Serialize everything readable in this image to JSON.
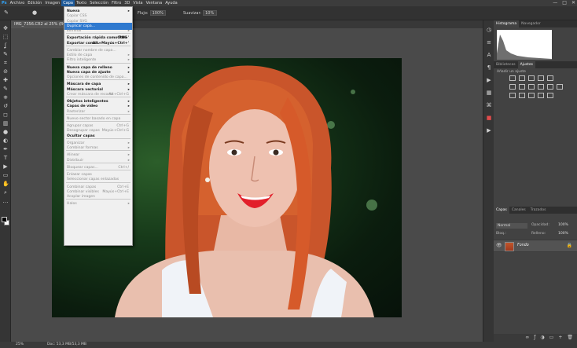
{
  "menubar": {
    "items": [
      "Archivo",
      "Edición",
      "Imagen",
      "Capa",
      "Texto",
      "Selección",
      "Filtro",
      "3D",
      "Vista",
      "Ventana",
      "Ayuda"
    ],
    "active": "Capa",
    "window_controls": [
      "—",
      "□",
      "✕"
    ]
  },
  "options": {
    "flujo_label": "Flujo:",
    "flujo_value": "100%",
    "suavizar_label": "Suavizar:",
    "suavizar_value": "10%"
  },
  "document_tab": "IMG_7356.CR2 al 25% (RGB",
  "status": {
    "zoom": "25%",
    "doc": "Doc: 53,3 MB/53,3 MB"
  },
  "menu": {
    "items": [
      {
        "label": "Nueva",
        "style": "bold",
        "arrow": true
      },
      {
        "label": "Copiar CSS",
        "style": "dis"
      },
      {
        "label": "Copiar SVG",
        "style": "dis"
      },
      {
        "label": "Duplicar capa...",
        "style": "hl"
      },
      {
        "label": "Eliminar",
        "style": "dis",
        "arrow": true
      },
      {
        "sep": true
      },
      {
        "label": "Exportación rápida como PNG",
        "style": "bold",
        "shortcut": "Ctrl+'"
      },
      {
        "label": "Exportar como...",
        "style": "bold",
        "shortcut": "Alt+Mayús+Ctrl+'"
      },
      {
        "sep": true
      },
      {
        "label": "Cambiar nombre de capa...",
        "style": "dis"
      },
      {
        "label": "Estilo de capa",
        "style": "dis",
        "arrow": true
      },
      {
        "label": "Filtro inteligente",
        "style": "dis",
        "arrow": true
      },
      {
        "sep": true
      },
      {
        "label": "Nueva capa de relleno",
        "style": "bold",
        "arrow": true
      },
      {
        "label": "Nueva capa de ajuste",
        "style": "bold",
        "arrow": true
      },
      {
        "label": "Opciones de contenido de capa...",
        "style": "dis"
      },
      {
        "sep": true
      },
      {
        "label": "Máscara de capa",
        "style": "bold",
        "arrow": true
      },
      {
        "label": "Máscara vectorial",
        "style": "bold",
        "arrow": true
      },
      {
        "label": "Crear máscara de recorte",
        "style": "dis",
        "shortcut": "Alt+Ctrl+G"
      },
      {
        "sep": true
      },
      {
        "label": "Objetos inteligentes",
        "style": "bold",
        "arrow": true
      },
      {
        "label": "Capas de vídeo",
        "style": "bold",
        "arrow": true
      },
      {
        "label": "Rasterizar",
        "style": "dis",
        "arrow": true
      },
      {
        "sep": true
      },
      {
        "label": "Nuevo sector basado en capa",
        "style": "dis"
      },
      {
        "sep": true
      },
      {
        "label": "Agrupar capas",
        "style": "dis",
        "shortcut": "Ctrl+G"
      },
      {
        "label": "Desagrupar capas",
        "style": "dis",
        "shortcut": "Mayús+Ctrl+G"
      },
      {
        "label": "Ocultar capas",
        "style": "bold"
      },
      {
        "sep": true
      },
      {
        "label": "Organizar",
        "style": "dis",
        "arrow": true
      },
      {
        "label": "Combinar formas",
        "style": "dis",
        "arrow": true
      },
      {
        "sep": true
      },
      {
        "label": "Alinear",
        "style": "dis",
        "arrow": true
      },
      {
        "label": "Distribuir",
        "style": "dis",
        "arrow": true
      },
      {
        "sep": true
      },
      {
        "label": "Bloquear capas...",
        "style": "dis",
        "shortcut": "Ctrl+/"
      },
      {
        "sep": true
      },
      {
        "label": "Enlazar capas",
        "style": "dis"
      },
      {
        "label": "Seleccionar capas enlazadas",
        "style": "dis"
      },
      {
        "sep": true
      },
      {
        "label": "Combinar capas",
        "style": "dis",
        "shortcut": "Ctrl+E"
      },
      {
        "label": "Combinar visibles",
        "style": "dis",
        "shortcut": "Mayús+Ctrl+E"
      },
      {
        "label": "Acoplar imagen",
        "style": "dis"
      },
      {
        "sep": true
      },
      {
        "label": "Halos",
        "style": "dis",
        "arrow": true
      }
    ]
  },
  "panels": {
    "top_tabs": [
      "Histograma",
      "Navegador"
    ],
    "mid_tabs": [
      "Bibliotecas",
      "Ajustes"
    ],
    "adjust_label": "Añadir un ajuste",
    "layer_tabs": [
      "Capas",
      "Canales",
      "Trazados"
    ],
    "blend_mode": "Normal",
    "opacity_label": "Opacidad:",
    "opacity_value": "100%",
    "fill_label": "Relleno:",
    "fill_value": "100%",
    "lock_label": "Bloq.:",
    "layer_name": "Fondo"
  },
  "colors": {
    "highlight": "#2f79cf",
    "hair": "#c9552b"
  }
}
